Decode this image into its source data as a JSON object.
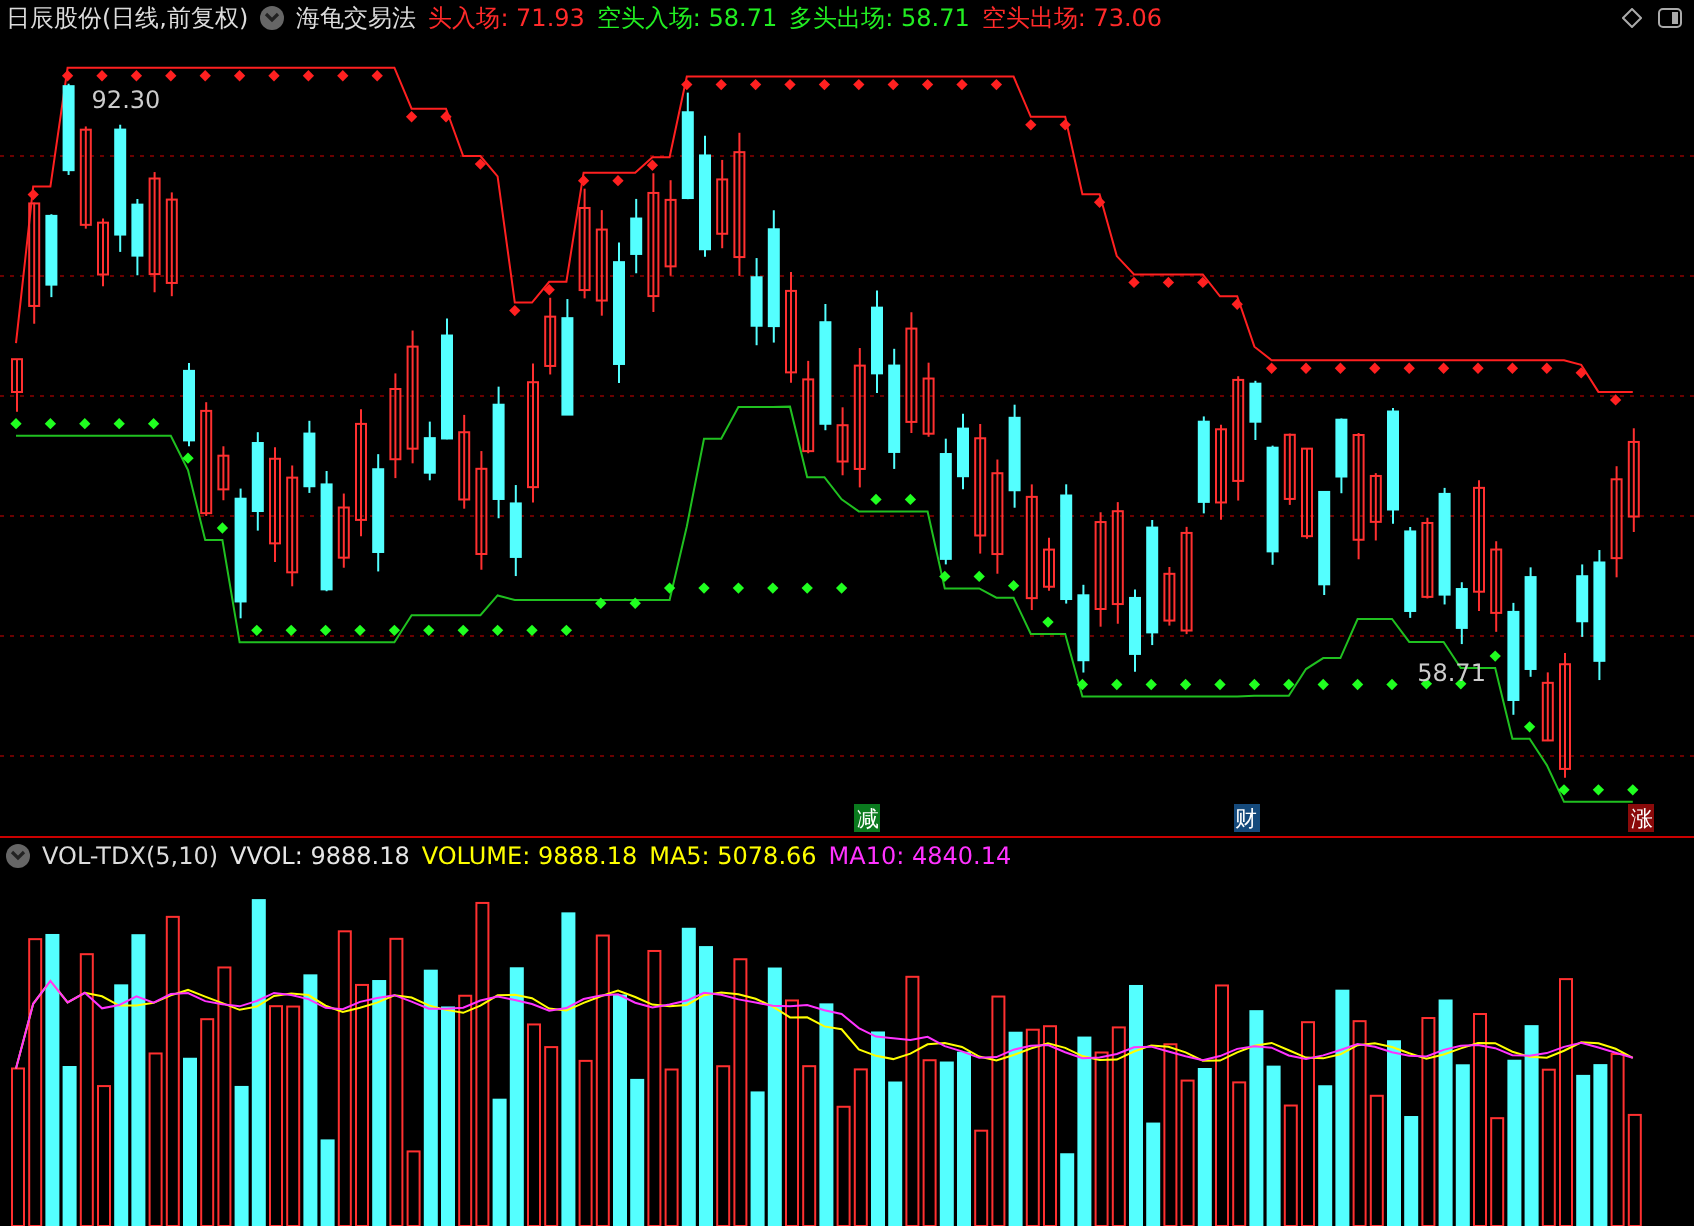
{
  "chart_header": {
    "title": "日辰股份(日线,前复权)",
    "indicator": "海龟交易法",
    "values": [
      {
        "label": "头入场: 71.93",
        "color": "#ff2a2a"
      },
      {
        "label": "空头入场: 58.71",
        "color": "#22ee22"
      },
      {
        "label": "多头出场: 58.71",
        "color": "#22ee22"
      },
      {
        "label": "空头出场: 73.06",
        "color": "#ff2a2a"
      }
    ]
  },
  "price_labels": {
    "high": "92.30",
    "low": "58.71"
  },
  "markers": [
    {
      "text": "减",
      "color": "#0a7a1e"
    },
    {
      "text": "财",
      "color": "#154a7c"
    },
    {
      "text": "涨",
      "color": "#8a0a0a"
    }
  ],
  "volume_header": {
    "name": "VOL-TDX(5,10)",
    "values": [
      {
        "label": "VVOL: 9888.18",
        "color": "#e6e6e6"
      },
      {
        "label": "VOLUME: 9888.18",
        "color": "#ffff00"
      },
      {
        "label": "MA5: 5078.66",
        "color": "#ffff00"
      },
      {
        "label": "MA10: 4840.14",
        "color": "#ff33ff"
      }
    ]
  }
}
